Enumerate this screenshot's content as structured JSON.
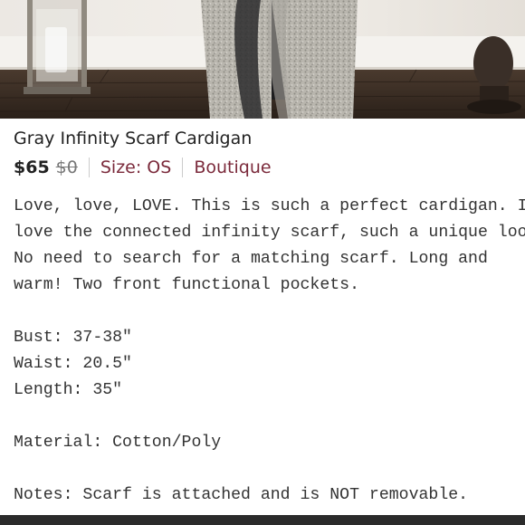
{
  "listing": {
    "title": "Gray Infinity Scarf Cardigan",
    "price": "$65",
    "original_price": "$0",
    "size": "Size: OS",
    "brand": "Boutique",
    "description": "Love, love, LOVE. This is such a perfect cardigan. I\nlove the connected infinity scarf, such a unique look.\nNo need to search for a matching scarf. Long and\nwarm! Two front functional pockets.\n\nBust: 37-38\"\nWaist: 20.5\"\nLength: 35\"\n\nMaterial: Cotton/Poly\n\nNotes: Scarf is attached and is NOT removable."
  },
  "colors": {
    "price_text": "#222222",
    "accent_maroon": "#7b2a3b",
    "bottom_bar": "#2b2b2b"
  }
}
